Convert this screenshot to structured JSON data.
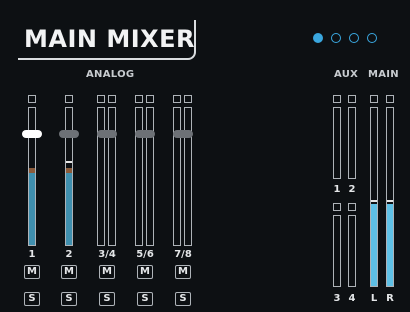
{
  "title": "MAIN MIXER",
  "pagination": {
    "count": 4,
    "active_index": 0,
    "color": "#3aa7df"
  },
  "sections": {
    "analog": "ANALOG",
    "aux": "AUX",
    "main": "MAIN"
  },
  "channels": [
    {
      "label": "1",
      "selected": true,
      "level": 0.73
    },
    {
      "label": "2",
      "selected": false,
      "level": 0.73
    },
    {
      "label": "3/4",
      "selected": false,
      "level": 0
    },
    {
      "label": "5/6",
      "selected": false,
      "level": 0
    },
    {
      "label": "7/8",
      "selected": false,
      "level": 0
    }
  ],
  "buttons": {
    "mute": "M",
    "solo": "S"
  },
  "aux_labels": {
    "a1": "1",
    "a2": "2",
    "a3": "3",
    "a4": "4"
  },
  "main_labels": {
    "left": "L",
    "right": "R"
  },
  "main_level": 0.52,
  "colors": {
    "meter_fill": "#3f8fae",
    "main_fill": "#5ec0e6",
    "peak": "#8b5b3a"
  }
}
